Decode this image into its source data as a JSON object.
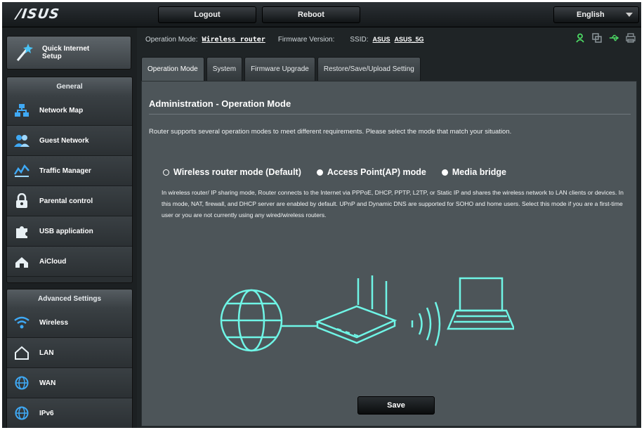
{
  "brand": {
    "logo": "/ISUS"
  },
  "topbar": {
    "logout": "Logout",
    "reboot": "Reboot",
    "language": "English"
  },
  "sidebar": {
    "quick_setup": "Quick Internet\nSetup",
    "general_header": "General",
    "general_items": [
      {
        "label": "Network Map",
        "icon": "network-map-icon"
      },
      {
        "label": "Guest Network",
        "icon": "guest-network-icon"
      },
      {
        "label": "Traffic Manager",
        "icon": "traffic-manager-icon"
      },
      {
        "label": "Parental control",
        "icon": "lock-icon"
      },
      {
        "label": "USB application",
        "icon": "puzzle-icon"
      },
      {
        "label": "AiCloud",
        "icon": "cloud-icon"
      }
    ],
    "advanced_header": "Advanced Settings",
    "advanced_items": [
      {
        "label": "Wireless",
        "icon": "wifi-icon"
      },
      {
        "label": "LAN",
        "icon": "house-icon"
      },
      {
        "label": "WAN",
        "icon": "globe-icon"
      },
      {
        "label": "IPv6",
        "icon": "globe-icon"
      }
    ]
  },
  "status": {
    "op_mode_label": "Operation Mode:",
    "op_mode_value": "Wireless router",
    "firmware_label": "Firmware Version:",
    "ssid_label": "SSID:",
    "ssid_1": "ASUS",
    "ssid_2": "ASUS_5G"
  },
  "tabs": [
    "Operation Mode",
    "System",
    "Firmware Upgrade",
    "Restore/Save/Upload Setting"
  ],
  "panel": {
    "title": "Administration - Operation Mode",
    "description": "Router supports several operation modes to meet different requirements. Please select the mode that match your situation.",
    "modes": [
      {
        "label": "Wireless router mode (Default)",
        "selected": true
      },
      {
        "label": "Access Point(AP) mode",
        "selected": false
      },
      {
        "label": "Media bridge",
        "selected": false
      }
    ],
    "mode_description": "In wireless router/ IP sharing mode, Router connects to the Internet via PPPoE, DHCP, PPTP, L2TP, or Static IP and shares the wireless network to LAN clients or devices. In this mode, NAT, firewall, and DHCP server are enabled by default. UPnP and Dynamic DNS are supported for SOHO and home users. Select this mode if you are a first-time user or you are not currently using any wired/wireless routers.",
    "save": "Save"
  },
  "colors": {
    "accent_cyan": "#6ff5e6",
    "panel_bg": "#4d5559",
    "bar_bg": "#1f2426"
  }
}
